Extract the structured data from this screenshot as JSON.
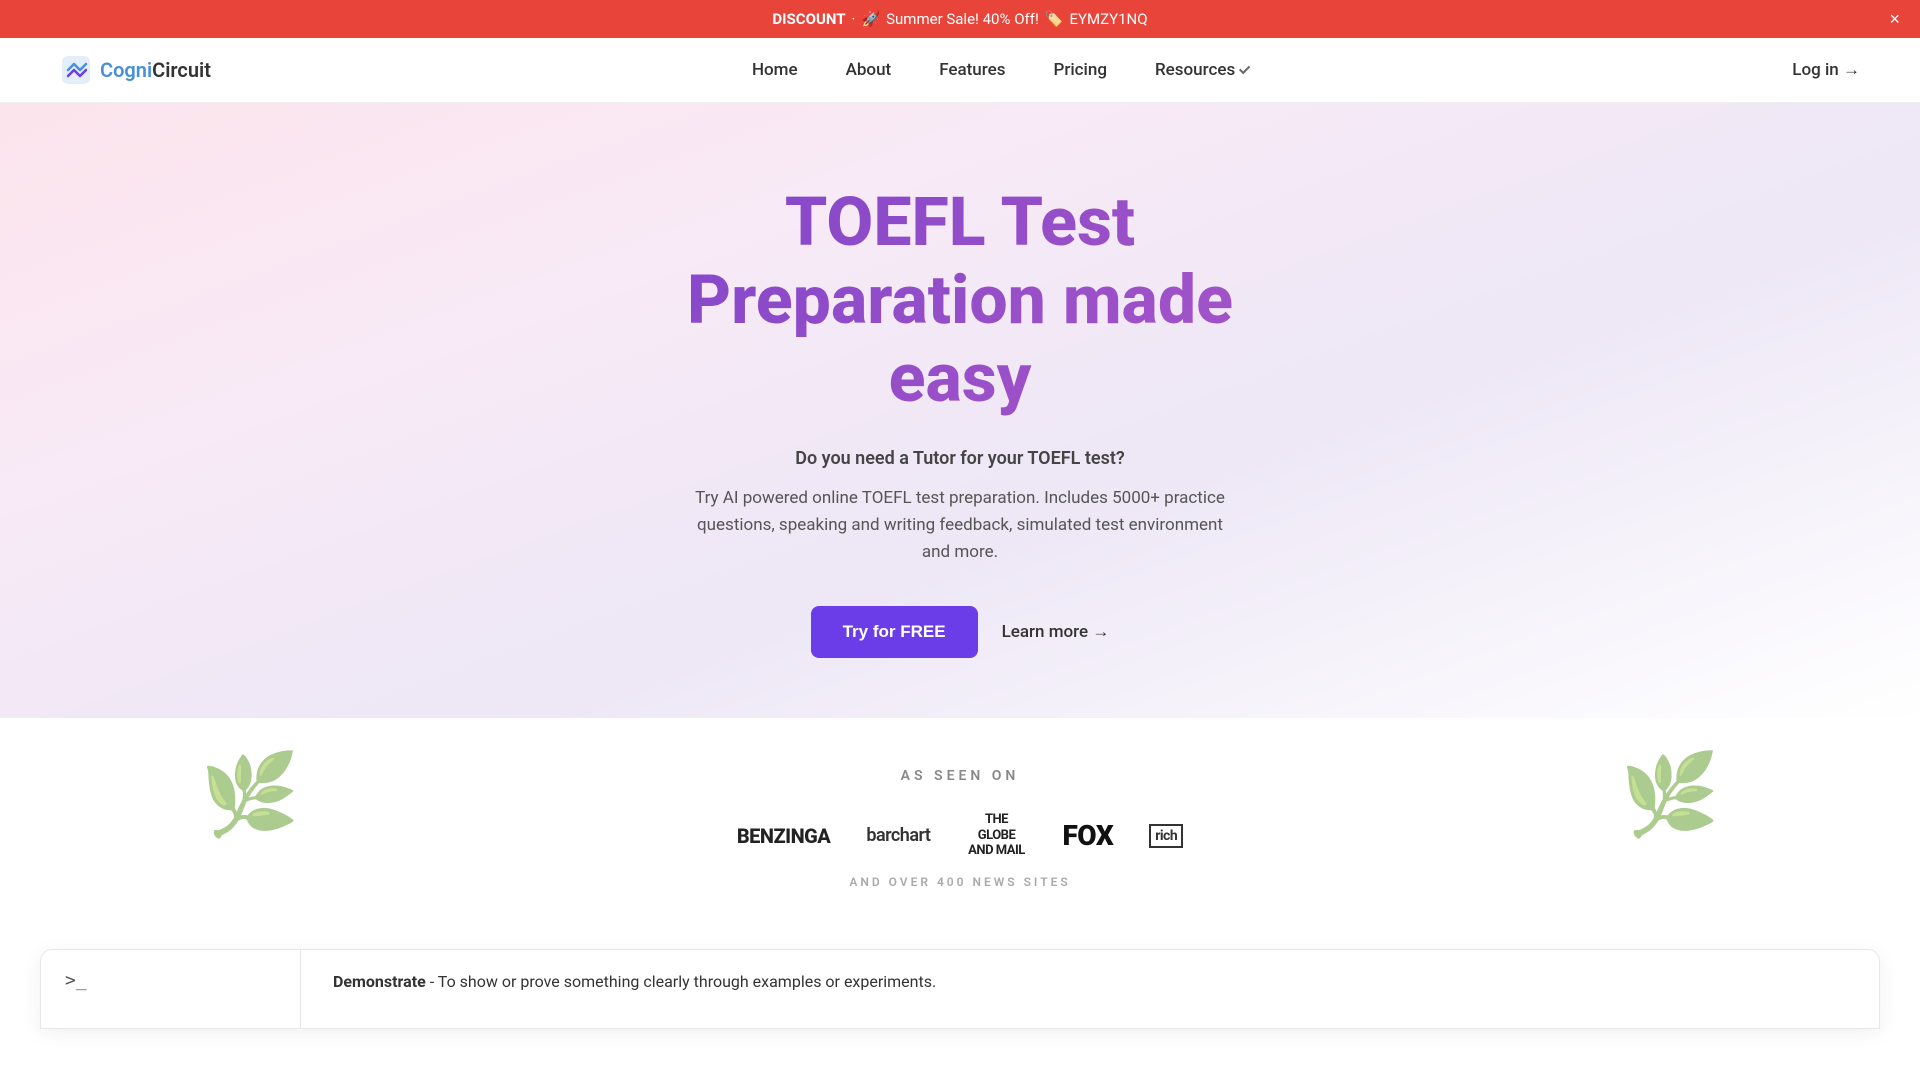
{
  "announcement": {
    "discount_label": "DISCOUNT",
    "dot": "·",
    "rocket_emoji": "🚀",
    "sale_text": "Summer Sale! 40% Off!",
    "tag_emoji": "🏷️",
    "code": "EYMZY1NQ",
    "close_label": "×"
  },
  "nav": {
    "logo_text_cogni": "Cogni",
    "logo_text_circuit": "Circuit",
    "links": [
      {
        "label": "Home",
        "id": "home"
      },
      {
        "label": "About",
        "id": "about"
      },
      {
        "label": "Features",
        "id": "features"
      },
      {
        "label": "Pricing",
        "id": "pricing"
      },
      {
        "label": "Resources",
        "id": "resources"
      }
    ],
    "login_label": "Log in →"
  },
  "hero": {
    "title_line1": "TOEFL Test",
    "title_line2": "Preparation made",
    "title_line3": "easy",
    "subtitle": "Do you need a Tutor for your TOEFL test?",
    "description": "Try AI powered online TOEFL test preparation. Includes 5000+ practice questions, speaking and writing feedback, simulated test environment and more.",
    "btn_try": "Try for FREE",
    "btn_learn": "Learn more →"
  },
  "as_seen_on": {
    "label": "AS SEEN ON",
    "logos": [
      {
        "text": "BENZINGA",
        "class": "benzinga"
      },
      {
        "text": "barchart",
        "class": "barchart"
      },
      {
        "text": "THE GLOBE AND MAIL",
        "class": "globe"
      },
      {
        "text": "FOX",
        "class": "fox"
      },
      {
        "text": "rich",
        "class": "rich"
      }
    ],
    "footer_text": "AND OVER 400 NEWS SITES"
  },
  "demo": {
    "prompt_symbol": ">_",
    "word": "Demonstrate",
    "definition": " - To show or prove something clearly through examples or experiments."
  }
}
